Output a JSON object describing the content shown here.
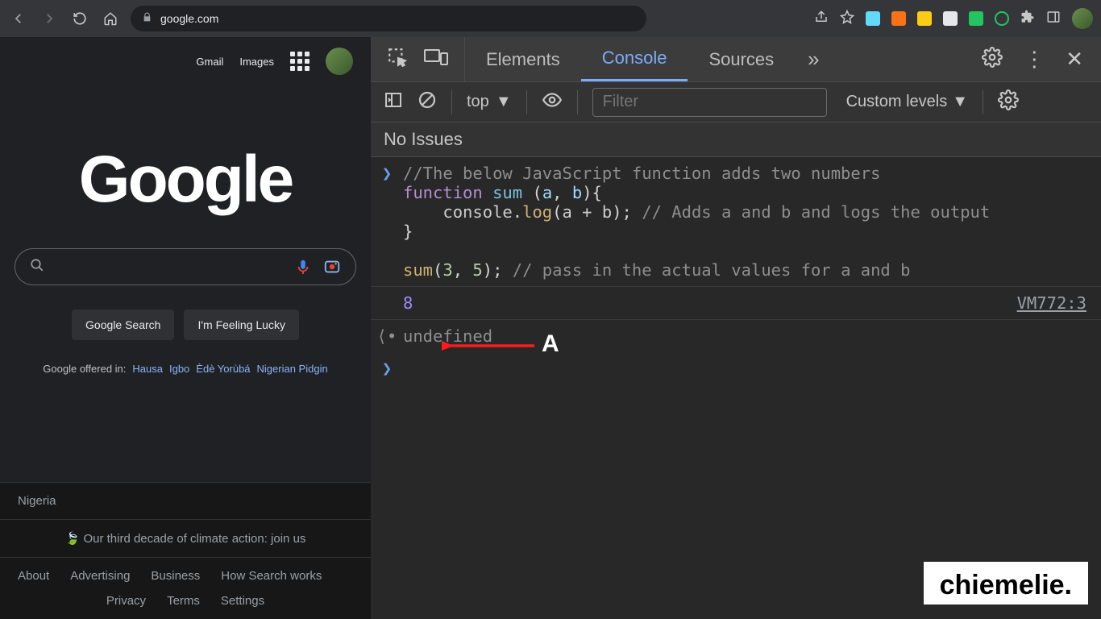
{
  "browser": {
    "url": "google.com",
    "ext_colors": [
      "#ff4d4d",
      "#f9a825",
      "#ffd54f",
      "#ffffff",
      "#43a047",
      "#26c6da",
      "#9e9e9e",
      "#e8eaed",
      "#6b8e4e"
    ]
  },
  "google": {
    "header": {
      "gmail": "Gmail",
      "images": "Images"
    },
    "logo": "Google",
    "buttons": {
      "search": "Google Search",
      "lucky": "I'm Feeling Lucky"
    },
    "offered_label": "Google offered in:",
    "offered": [
      "Hausa",
      "Igbo",
      "Èdè Yorùbá",
      "Nigerian Pidgin"
    ],
    "footer": {
      "region": "Nigeria",
      "climate": "Our third decade of climate action: join us",
      "row1": [
        "About",
        "Advertising",
        "Business",
        "How Search works"
      ],
      "row2": [
        "Privacy",
        "Terms",
        "Settings"
      ]
    }
  },
  "devtools": {
    "tabs": {
      "elements": "Elements",
      "console": "Console",
      "sources": "Sources",
      "more": "»"
    },
    "toolbar": {
      "context": "top",
      "filter_placeholder": "Filter",
      "levels": "Custom levels"
    },
    "issues": "No Issues",
    "code": {
      "comment1": "//The below JavaScript function adds two numbers",
      "fn_kw": "function",
      "fn_name": "sum",
      "p1": "a",
      "p2": "b",
      "body_obj": "console",
      "body_method": "log",
      "body_args": "a + b",
      "body_comment": "// Adds a and b and logs the output",
      "call_name": "sum",
      "call_a": "3",
      "call_b": "5",
      "call_comment": "// pass in the actual values for a and b"
    },
    "output": {
      "value": "8",
      "source": "VM772:3"
    },
    "return": "undefined"
  },
  "annotation": {
    "label": "A"
  },
  "watermark": "chiemelie."
}
